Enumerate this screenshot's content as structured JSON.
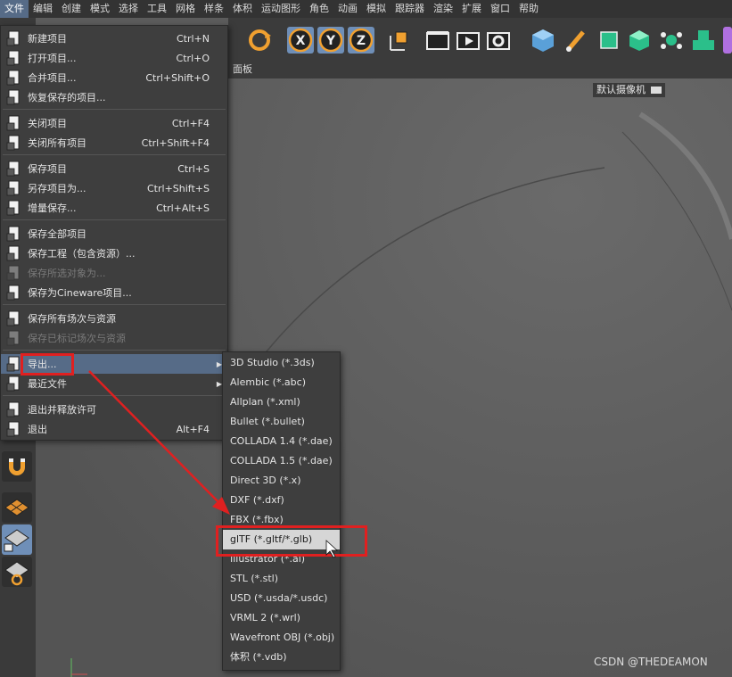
{
  "menubar": {
    "items": [
      "文件",
      "编辑",
      "创建",
      "模式",
      "选择",
      "工具",
      "网格",
      "样条",
      "体积",
      "运动图形",
      "角色",
      "动画",
      "模拟",
      "跟踪器",
      "渲染",
      "扩展",
      "窗口",
      "帮助"
    ],
    "active_index": 0
  },
  "toolbar": {
    "icons": [
      "rotate-tool-icon",
      "x-axis-icon",
      "y-axis-icon",
      "z-axis-icon",
      "coordinate-system-icon",
      "render-region-icon",
      "render-view-icon",
      "render-settings-icon",
      "cube-icon",
      "pen-icon",
      "subdivision-icon",
      "extrude-icon",
      "cloner-icon",
      "array-icon",
      "deformer-icon"
    ]
  },
  "panel": {
    "label": "面板"
  },
  "viewport": {
    "camera_label": "默认摄像机",
    "camera_icon": "camera-icon"
  },
  "file_menu": {
    "items": [
      {
        "label": "新建项目",
        "shortcut": "Ctrl+N",
        "icon": "new-file-icon"
      },
      {
        "label": "打开项目...",
        "shortcut": "Ctrl+O",
        "icon": "open-file-icon"
      },
      {
        "label": "合并项目...",
        "shortcut": "Ctrl+Shift+O",
        "icon": "merge-file-icon"
      },
      {
        "label": "恢复保存的项目...",
        "shortcut": "",
        "icon": "revert-file-icon"
      },
      {
        "label": "关闭项目",
        "shortcut": "Ctrl+F4",
        "icon": "close-file-icon"
      },
      {
        "label": "关闭所有项目",
        "shortcut": "Ctrl+Shift+F4",
        "icon": "close-all-icon"
      },
      {
        "label": "保存项目",
        "shortcut": "Ctrl+S",
        "icon": "save-icon"
      },
      {
        "label": "另存项目为...",
        "shortcut": "Ctrl+Shift+S",
        "icon": "save-as-icon"
      },
      {
        "label": "增量保存...",
        "shortcut": "Ctrl+Alt+S",
        "icon": "incremental-save-icon"
      },
      {
        "label": "保存全部项目",
        "shortcut": "",
        "icon": "save-all-icon"
      },
      {
        "label": "保存工程（包含资源）...",
        "shortcut": "",
        "icon": "save-with-assets-icon"
      },
      {
        "label": "保存所选对象为...",
        "shortcut": "",
        "icon": "save-selected-icon",
        "disabled": true
      },
      {
        "label": "保存为Cineware项目...",
        "shortcut": "",
        "icon": "cineware-icon"
      },
      {
        "label": "保存所有场次与资源",
        "shortcut": "",
        "icon": "save-takes-icon"
      },
      {
        "label": "保存已标记场次与资源",
        "shortcut": "",
        "icon": "save-marked-takes-icon",
        "disabled": true
      },
      {
        "label": "导出...",
        "shortcut": "",
        "icon": "export-icon",
        "submenu": true,
        "highlighted": true
      },
      {
        "label": "最近文件",
        "shortcut": "",
        "icon": "recent-files-icon",
        "submenu": true
      },
      {
        "label": "退出并释放许可",
        "shortcut": "",
        "icon": "exit-release-icon"
      },
      {
        "label": "退出",
        "shortcut": "Alt+F4",
        "icon": "exit-icon"
      }
    ]
  },
  "export_submenu": {
    "items": [
      "3D Studio (*.3ds)",
      "Alembic (*.abc)",
      "Allplan (*.xml)",
      "Bullet (*.bullet)",
      "COLLADA 1.4 (*.dae)",
      "COLLADA 1.5 (*.dae)",
      "Direct 3D (*.x)",
      "DXF (*.dxf)",
      "FBX (*.fbx)",
      "glTF (*.gltf/*.glb)",
      "Illustrator (*.ai)",
      "STL (*.stl)",
      "USD (*.usda/*.usdc)",
      "VRML 2 (*.wrl)",
      "Wavefront OBJ (*.obj)",
      "体积 (*.vdb)"
    ],
    "highlighted_index": 9
  },
  "left_tools": [
    "snap-magnet-icon",
    "workplane-icon",
    "locked-workplane-icon",
    "workplane-axis-icon"
  ],
  "watermark": "CSDN @THEDEAMON",
  "colors": {
    "menu_highlight": "#566b87",
    "annotation_red": "#e02020",
    "accent_orange": "#f0a030"
  }
}
